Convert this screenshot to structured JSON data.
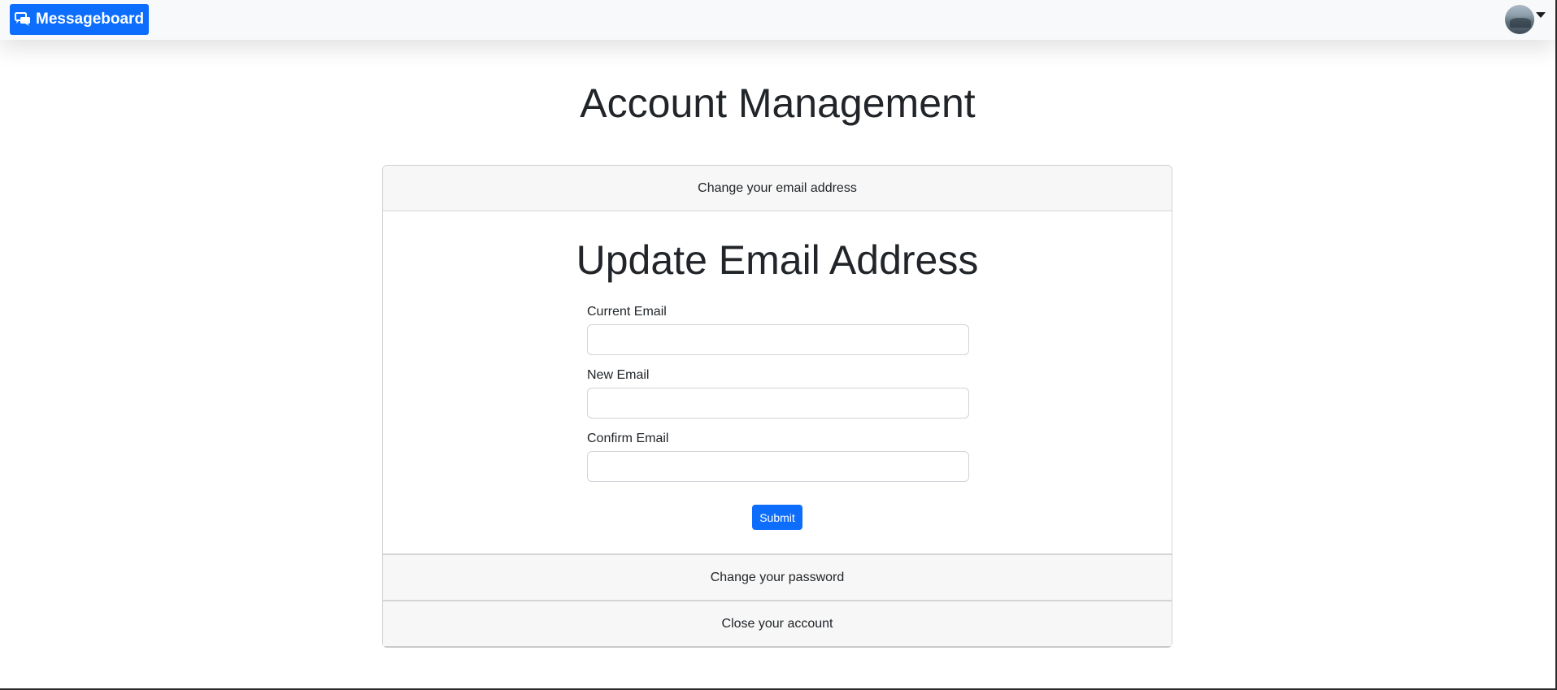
{
  "navbar": {
    "brand_label": "Messageboard",
    "brand_icon": "chat-bubbles-icon",
    "avatar_icon": "user-avatar",
    "dropdown_icon": "caret-down-icon"
  },
  "page": {
    "title": "Account Management"
  },
  "accordion": {
    "email": {
      "header": "Change your email address",
      "title": "Update Email Address",
      "fields": [
        {
          "label": "Current Email",
          "value": "",
          "placeholder": ""
        },
        {
          "label": "New Email",
          "value": "",
          "placeholder": ""
        },
        {
          "label": "Confirm Email",
          "value": "",
          "placeholder": ""
        }
      ],
      "submit_label": "Submit"
    },
    "password": {
      "header": "Change your password"
    },
    "close": {
      "header": "Close your account"
    }
  },
  "colors": {
    "primary": "#0d6efd",
    "navbar_bg": "#f8f9fa",
    "accordion_header_bg": "#f7f7f7"
  }
}
